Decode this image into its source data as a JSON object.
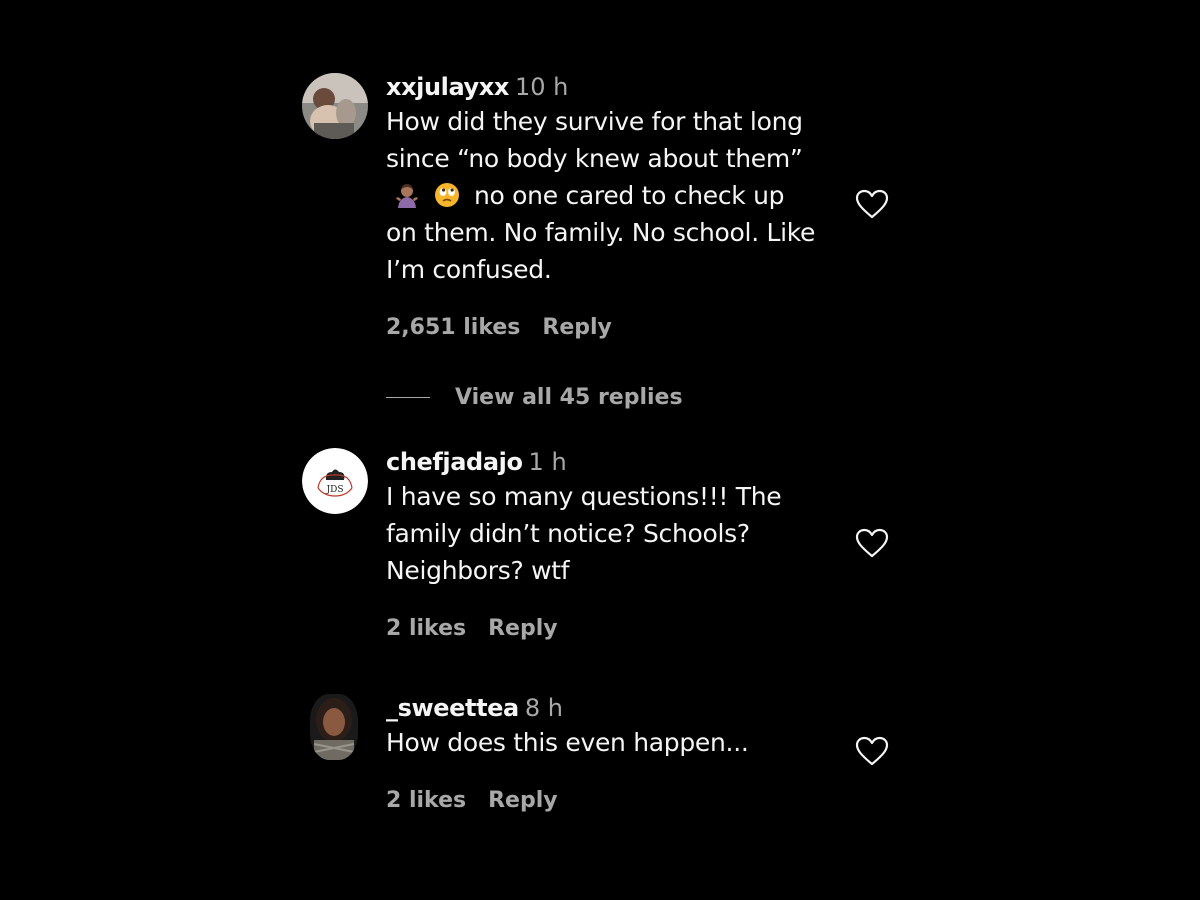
{
  "comments": [
    {
      "username": "xxjulayxx",
      "time": "10 h",
      "text_line1": "How did they survive for that long",
      "text_line2": "since “no body knew about them”",
      "text_line3_after_emoji": "no one cared to check up",
      "text_line4": "on them. No family. No school. Like",
      "text_line5": "I’m confused.",
      "emojis": [
        "woman-shrugging-emoji",
        "face-with-rolling-eyes-emoji"
      ],
      "likes": "2,651 likes",
      "reply": "Reply",
      "view_replies": "View all 45 replies"
    },
    {
      "username": "chefjadajo",
      "time": "1 h",
      "text_line1": "I have so many questions!!! The",
      "text_line2": "family didn’t notice? Schools?",
      "text_line3": "Neighbors? wtf",
      "avatar_logo_text": "JDS",
      "likes": "2 likes",
      "reply": "Reply"
    },
    {
      "username": "_sweettea",
      "time": "8 h",
      "text_line1": "How does this even happen...",
      "likes": "2 likes",
      "reply": "Reply"
    }
  ],
  "colors": {
    "background": "#000000",
    "primary_text": "#f5f5f5",
    "secondary_text": "#a8a8a8"
  }
}
